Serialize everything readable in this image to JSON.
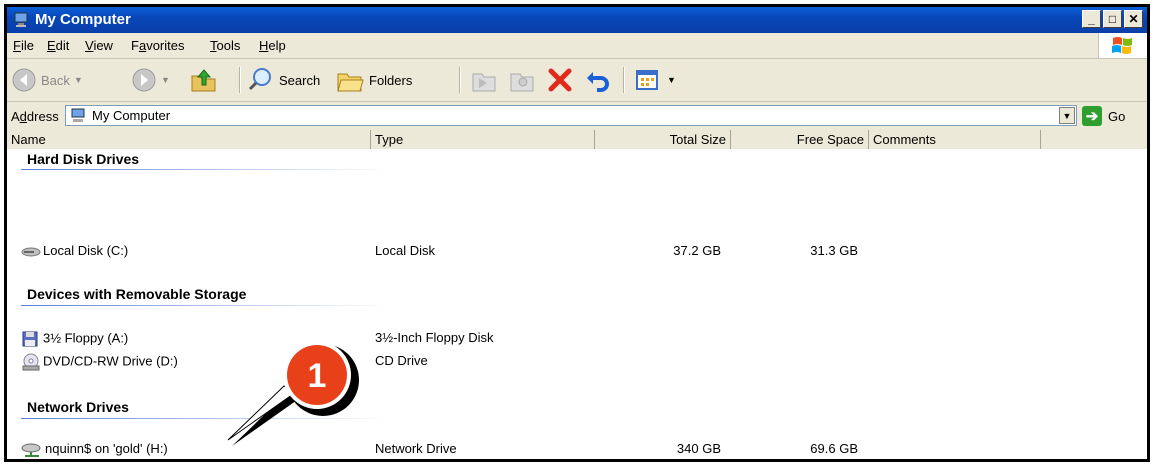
{
  "window": {
    "title": "My Computer"
  },
  "menu": {
    "items": [
      {
        "pre": "",
        "u": "F",
        "post": "ile"
      },
      {
        "pre": "",
        "u": "E",
        "post": "dit"
      },
      {
        "pre": "",
        "u": "V",
        "post": "iew"
      },
      {
        "pre": "F",
        "u": "a",
        "post": "vorites"
      },
      {
        "pre": "",
        "u": "T",
        "post": "ools"
      },
      {
        "pre": "",
        "u": "H",
        "post": "elp"
      }
    ]
  },
  "toolbar": {
    "back": "Back",
    "search": "Search",
    "folders": "Folders"
  },
  "address": {
    "label_u": "d",
    "label_pre": "A",
    "label_post": "dress",
    "value": "My Computer",
    "go": "Go"
  },
  "columns": {
    "name": "Name",
    "type": "Type",
    "total": "Total Size",
    "free": "Free Space",
    "comments": "Comments"
  },
  "groups": {
    "hdd": "Hard Disk Drives",
    "removable": "Devices with Removable Storage",
    "network": "Network Drives"
  },
  "rows": [
    {
      "name": "Local Disk (C:)",
      "type": "Local Disk",
      "total": "37.2 GB",
      "free": "31.3 GB",
      "icon": "hard-disk-icon"
    },
    {
      "name": "3½ Floppy (A:)",
      "type": "3½-Inch Floppy Disk",
      "total": "",
      "free": "",
      "icon": "floppy-icon"
    },
    {
      "name": "DVD/CD-RW Drive (D:)",
      "type": "CD Drive",
      "total": "",
      "free": "",
      "icon": "cd-drive-icon"
    },
    {
      "name": "nquinn$ on 'gold' (H:)",
      "type": "Network Drive",
      "total": "340 GB",
      "free": "69.6 GB",
      "icon": "network-drive-icon"
    }
  ],
  "callout": {
    "number": "1",
    "color": "#e8411a"
  }
}
